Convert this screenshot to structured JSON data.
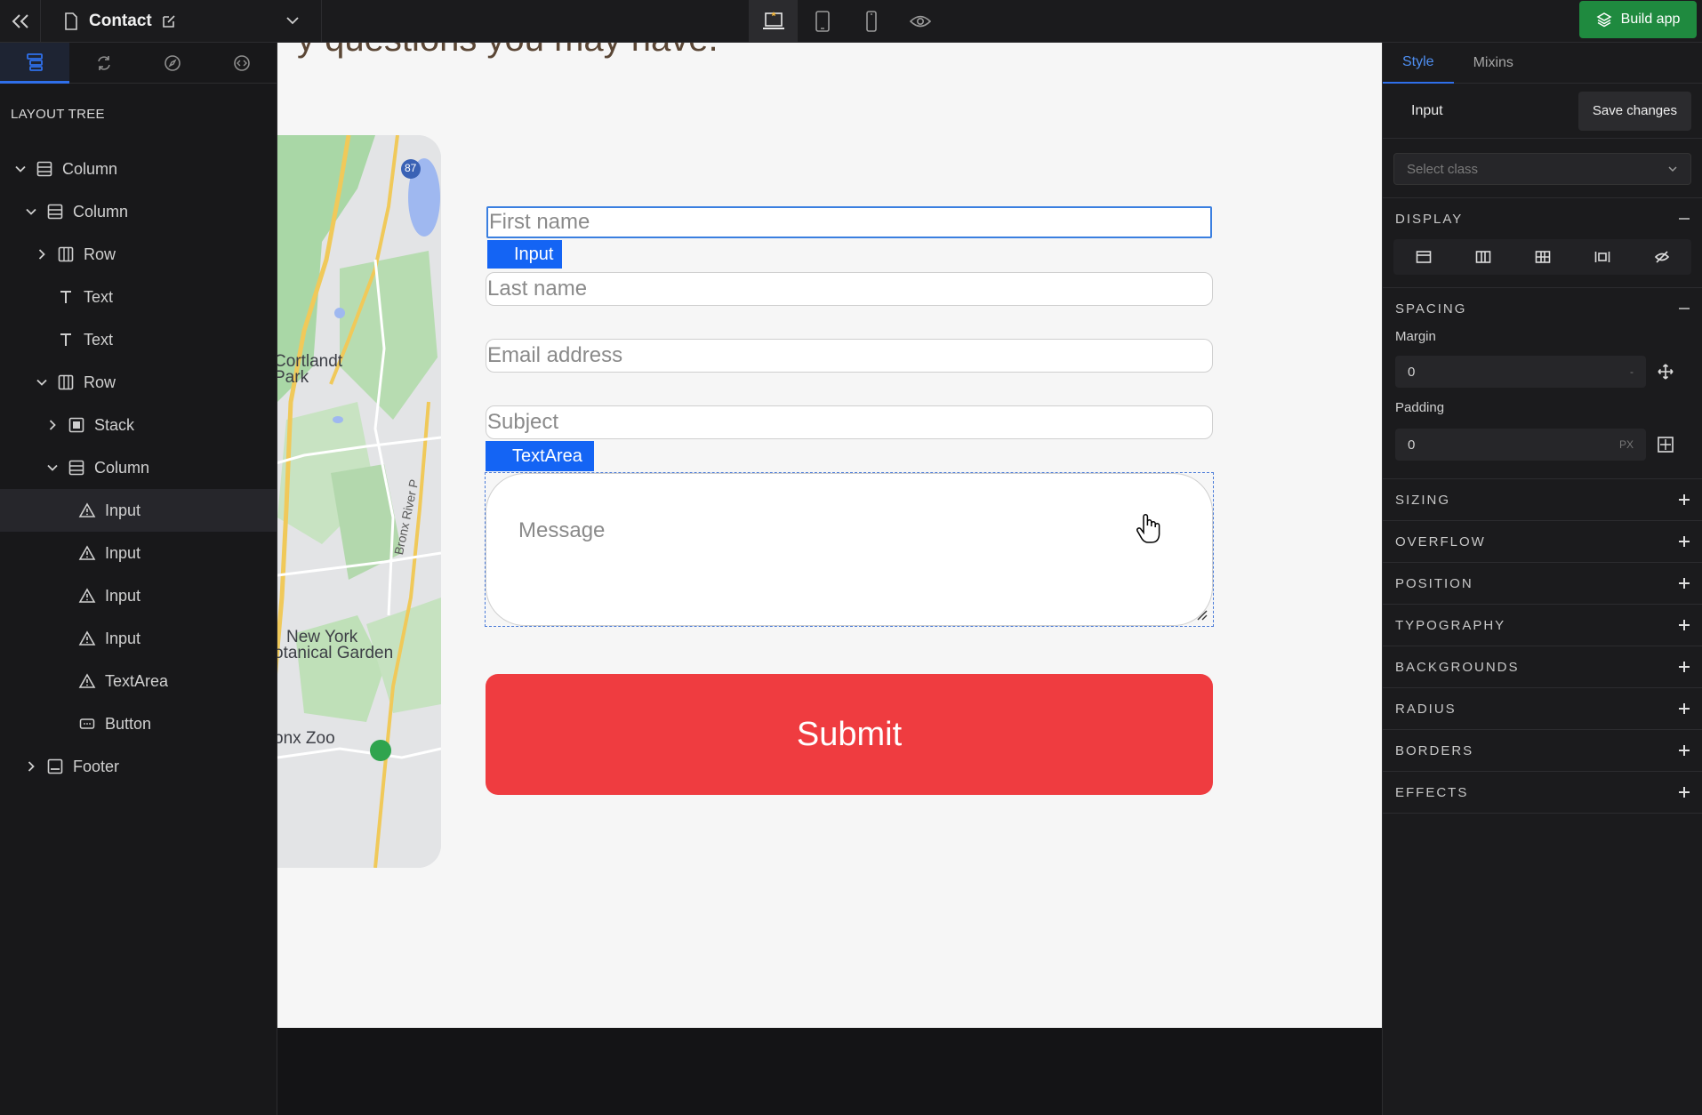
{
  "topbar": {
    "page_title": "Contact",
    "build_label": "Build app"
  },
  "sidebar": {
    "heading": "LAYOUT TREE",
    "items": [
      {
        "label": "Column",
        "icon": "column-icon",
        "caret": "expanded"
      },
      {
        "label": "Column",
        "icon": "column-icon",
        "caret": "expanded"
      },
      {
        "label": "Row",
        "icon": "row-icon",
        "caret": "collapsed"
      },
      {
        "label": "Text",
        "icon": "text-icon",
        "caret": "none"
      },
      {
        "label": "Text",
        "icon": "text-icon",
        "caret": "none"
      },
      {
        "label": "Row",
        "icon": "row-icon",
        "caret": "expanded"
      },
      {
        "label": "Stack",
        "icon": "stack-icon",
        "caret": "collapsed"
      },
      {
        "label": "Column",
        "icon": "column-icon",
        "caret": "expanded"
      },
      {
        "label": "Input",
        "icon": "warning-icon",
        "caret": "none",
        "selected": true
      },
      {
        "label": "Input",
        "icon": "warning-icon",
        "caret": "none"
      },
      {
        "label": "Input",
        "icon": "warning-icon",
        "caret": "none"
      },
      {
        "label": "Input",
        "icon": "warning-icon",
        "caret": "none"
      },
      {
        "label": "TextArea",
        "icon": "warning-icon",
        "caret": "none"
      },
      {
        "label": "Button",
        "icon": "button-icon",
        "caret": "none"
      },
      {
        "label": "Footer",
        "icon": "footer-icon",
        "caret": "collapsed"
      }
    ]
  },
  "canvas": {
    "heading_fragment": "y questions you may have.",
    "map_labels": {
      "park": "Cortlandt\nPark",
      "garden": "New York\notanical Garden",
      "zoo": "onx Zoo",
      "parkway": "Bronx River P",
      "highway": "87"
    },
    "fields": {
      "first_name": "First name",
      "last_name": "Last name",
      "email": "Email address",
      "subject": "Subject",
      "message": "Message"
    },
    "tags": {
      "input": "Input",
      "textarea": "TextArea"
    },
    "submit_label": "Submit"
  },
  "rpanel": {
    "tabs": [
      "Style",
      "Mixins"
    ],
    "element_name": "Input",
    "save_label": "Save changes",
    "select_class_placeholder": "Select class",
    "sections": {
      "display": "DISPLAY",
      "spacing": "SPACING",
      "sizing": "SIZING",
      "overflow": "OVERFLOW",
      "position": "POSITION",
      "typography": "TYPOGRAPHY",
      "backgrounds": "BACKGROUNDS",
      "radius": "RADIUS",
      "borders": "BORDERS",
      "effects": "EFFECTS"
    },
    "margin_label": "Margin",
    "margin_value": "0",
    "margin_unit": "-",
    "padding_label": "Padding",
    "padding_value": "0",
    "padding_unit": "PX"
  },
  "colors": {
    "accent": "#1464f4",
    "build_green": "#1f8a3f",
    "submit_red": "#ef3c40",
    "selection_blue": "#3a7fe0"
  }
}
